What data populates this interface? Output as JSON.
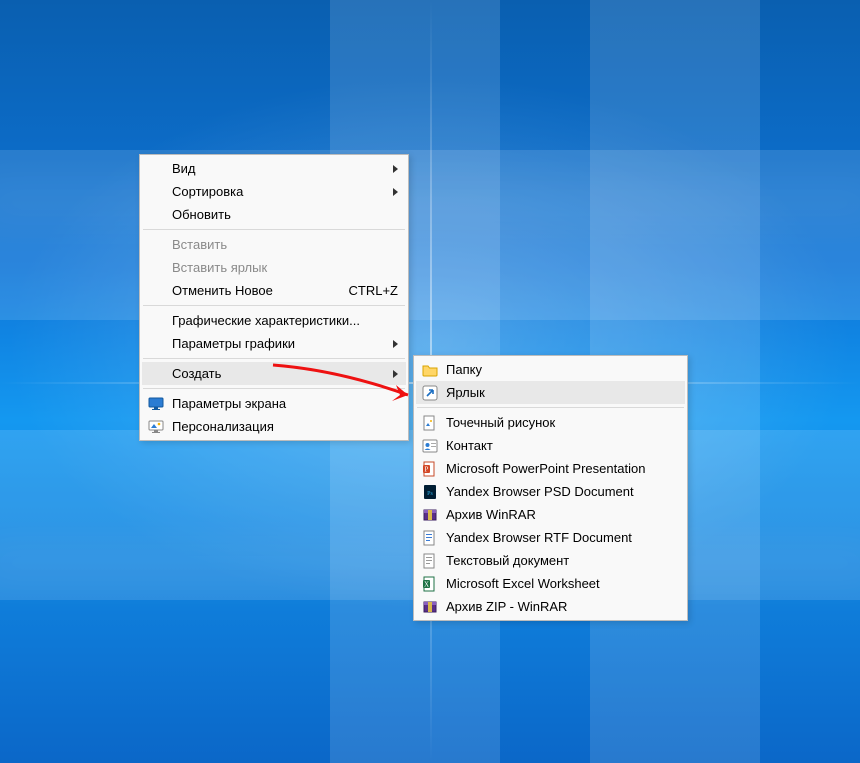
{
  "context_menu": {
    "items": [
      {
        "label": "Вид",
        "submenu": true
      },
      {
        "label": "Сортировка",
        "submenu": true
      },
      {
        "label": "Обновить"
      },
      {
        "sep": true
      },
      {
        "label": "Вставить",
        "disabled": true
      },
      {
        "label": "Вставить ярлык",
        "disabled": true
      },
      {
        "label": "Отменить Новое",
        "shortcut": "CTRL+Z"
      },
      {
        "sep": true
      },
      {
        "label": "Графические характеристики..."
      },
      {
        "label": "Параметры графики",
        "submenu": true
      },
      {
        "sep": true
      },
      {
        "label": "Создать",
        "submenu": true,
        "highlight": true
      },
      {
        "sep": true
      },
      {
        "label": "Параметры экрана",
        "icon": "display-icon"
      },
      {
        "label": "Персонализация",
        "icon": "personalize-icon"
      }
    ]
  },
  "submenu_create": {
    "items": [
      {
        "label": "Папку",
        "icon": "folder-icon"
      },
      {
        "label": "Ярлык",
        "icon": "shortcut-icon",
        "highlight": true
      },
      {
        "sep": true
      },
      {
        "label": "Точечный рисунок",
        "icon": "bitmap-icon"
      },
      {
        "label": "Контакт",
        "icon": "contact-icon"
      },
      {
        "label": "Microsoft PowerPoint Presentation",
        "icon": "powerpoint-icon"
      },
      {
        "label": "Yandex Browser PSD Document",
        "icon": "psd-icon"
      },
      {
        "label": "Архив WinRAR",
        "icon": "winrar-icon"
      },
      {
        "label": "Yandex Browser RTF Document",
        "icon": "rtf-icon"
      },
      {
        "label": "Текстовый документ",
        "icon": "text-icon"
      },
      {
        "label": "Microsoft Excel Worksheet",
        "icon": "excel-icon"
      },
      {
        "label": "Архив ZIP - WinRAR",
        "icon": "winrar-icon"
      }
    ]
  },
  "icons": {
    "display-icon": "<svg viewBox='0 0 16 16'><rect x='1' y='2' width='14' height='9' rx='1' fill='#2b7cd3' stroke='#13599e'/><rect x='6' y='11' width='4' height='2' fill='#13599e'/><rect x='4' y='13' width='8' height='1' fill='#13599e'/></svg>",
    "personalize-icon": "<svg viewBox='0 0 16 16'><rect x='1' y='2' width='14' height='9' rx='1' fill='#fff' stroke='#888'/><path d='M3 9 L6 5 L9 9 Z' fill='#2b7cd3'/><circle cx='11' cy='5' r='1.3' fill='#f5b301'/><rect x='4' y='13' width='8' height='1' fill='#888'/><rect x='6' y='11' width='4' height='2' fill='#888'/></svg>",
    "folder-icon": "<svg viewBox='0 0 16 16'><path d='M1 4 h5 l1.5 2 H15 v7 a1 1 0 0 1 -1 1 H2 a1 1 0 0 1 -1 -1 Z' fill='#ffd667' stroke='#d9a400'/></svg>",
    "shortcut-icon": "<svg viewBox='0 0 16 16'><rect x='1' y='1' width='14' height='14' rx='2' fill='#fff' stroke='#888'/><path d='M5 11 L11 5 M11 5 h-4 M11 5 v4' stroke='#1b6ec2' stroke-width='1.6' fill='none'/></svg>",
    "bitmap-icon": "<svg viewBox='0 0 16 16'><rect x='2' y='1' width='10' height='14' fill='#fff' stroke='#888'/><path d='M4 11 L6 8 L8 11 Z' fill='#2b7cd3'/><circle cx='9' cy='6' r='1' fill='#f5b301'/></svg>",
    "contact-icon": "<svg viewBox='0 0 16 16'><rect x='1' y='2' width='14' height='12' rx='1' fill='#fff' stroke='#888'/><circle cx='5.5' cy='7' r='2' fill='#2b7cd3'/><path d='M2.5 12 q3 -3 6 0' fill='#2b7cd3'/><rect x='9' y='5' width='5' height='1' fill='#aaa'/><rect x='9' y='8' width='5' height='1' fill='#aaa'/></svg>",
    "powerpoint-icon": "<svg viewBox='0 0 16 16'><rect x='2' y='1' width='10' height='14' fill='#fff' stroke='#c74a28'/><rect x='1' y='4' width='7' height='8' rx='1' fill='#d24726'/><text x='4.5' y='10.5' text-anchor='middle' font-size='7' fill='#fff' font-family='Segoe UI'>P</text></svg>",
    "psd-icon": "<svg viewBox='0 0 16 16'><rect x='2' y='1' width='12' height='14' rx='1' fill='#001d33'/><text x='8' y='11' text-anchor='middle' font-size='6' fill='#29abe2' font-family='Segoe UI'>Ps</text></svg>",
    "winrar-icon": "<svg viewBox='0 0 16 16'><rect x='2' y='3' width='12' height='10' fill='#5a2e8a' stroke='#3b1d5e'/><rect x='2' y='3' width='12' height='3' fill='#8a5fbf'/><rect x='6' y='3' width='4' height='10' fill='#d9b84a'/></svg>",
    "rtf-icon": "<svg viewBox='0 0 16 16'><rect x='2' y='1' width='10' height='14' fill='#fff' stroke='#888'/><rect x='4' y='4' width='6' height='1' fill='#3a7bd5'/><rect x='4' y='7' width='6' height='1' fill='#3a7bd5'/><rect x='4' y='10' width='4' height='1' fill='#3a7bd5'/></svg>",
    "text-icon": "<svg viewBox='0 0 16 16'><rect x='2' y='1' width='10' height='14' fill='#fff' stroke='#888'/><rect x='4' y='4' width='6' height='1' fill='#999'/><rect x='4' y='7' width='6' height='1' fill='#999'/><rect x='4' y='10' width='4' height='1' fill='#999'/></svg>",
    "excel-icon": "<svg viewBox='0 0 16 16'><rect x='2' y='1' width='10' height='14' fill='#fff' stroke='#1e7145'/><rect x='1' y='4' width='7' height='8' rx='1' fill='#1e7145'/><text x='4.5' y='10.5' text-anchor='middle' font-size='7' fill='#fff' font-family='Segoe UI'>X</text></svg>"
  }
}
